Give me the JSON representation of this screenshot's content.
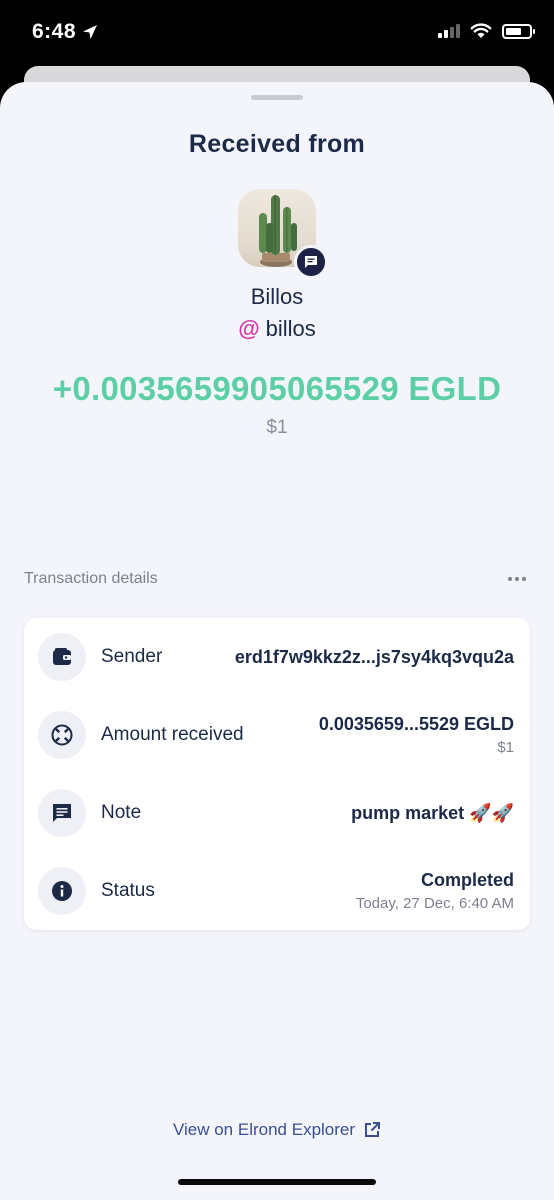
{
  "status_bar": {
    "time": "6:48"
  },
  "sheet": {
    "title": "Received from",
    "sender_name": "Billos",
    "sender_handle_prefix": "@",
    "sender_handle": "billos",
    "amount": "+0.0035659905065529 EGLD",
    "fiat": "$1"
  },
  "details": {
    "section_label": "Transaction details",
    "rows": [
      {
        "label": "Sender",
        "value": "erd1f7w9kkz2z...js7sy4kq3vqu2a",
        "icon": "wallet-icon"
      },
      {
        "label": "Amount received",
        "value": "0.0035659...5529 EGLD",
        "sub": "$1",
        "icon": "egld-icon"
      },
      {
        "label": "Note",
        "value": "pump market 🚀🚀",
        "icon": "note-icon"
      },
      {
        "label": "Status",
        "value": "Completed",
        "sub": "Today, 27 Dec, 6:40 AM",
        "icon": "info-icon"
      }
    ]
  },
  "footer": {
    "explorer_link": "View on Elrond Explorer"
  },
  "colors": {
    "amount_green": "#5ccfa6",
    "navy": "#1c2a48",
    "handle_pink": "#d63aa8",
    "background": "#f4f5fb"
  }
}
